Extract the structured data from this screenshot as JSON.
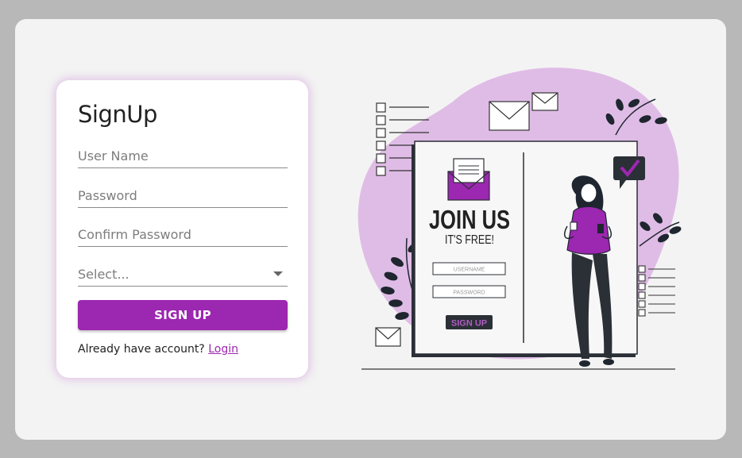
{
  "form": {
    "title": "SignUp",
    "username_placeholder": "User Name",
    "password_placeholder": "Password",
    "confirm_placeholder": "Confirm Password",
    "select_placeholder": "Select...",
    "submit_label": "SIGN UP",
    "footer_text": "Already have account?",
    "login_link": "Login"
  },
  "illustration": {
    "headline": "JOIN US",
    "subheadline": "IT'S FREE!",
    "username_label": "USERNAME",
    "password_label": "PASSWORD",
    "button_label": "SIGN UP"
  },
  "colors": {
    "accent": "#9c27b0",
    "blob": "#dfbce6",
    "page_bg": "#b8b8b8",
    "panel_bg": "#f3f3f3"
  }
}
